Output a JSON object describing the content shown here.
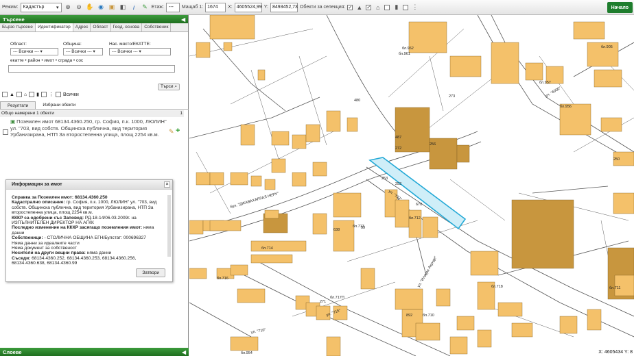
{
  "toolbar": {
    "mode_label": "Режим:",
    "mode_value": "Кадастър",
    "floor_label": "Етаж:",
    "floor_value": "---",
    "scale_label": "Мащаб 1:",
    "scale_value": "1674",
    "x_label": "X:",
    "x_value": "4605524,99",
    "y_label": "Y:",
    "y_value": "8493452,73",
    "objects_label": "Обекти за селекция:",
    "start_label": "Начало"
  },
  "panel": {
    "title": "Търсене",
    "tabs": [
      "Бързо търсене",
      "Идентификатор",
      "Адрес",
      "Област",
      "Геод. основа",
      "Собственик"
    ],
    "area_label": "Област:",
    "area_value": "--- Всички ---",
    "municipality_label": "Община:",
    "municipality_value": "--- Всички ---",
    "settlement_label": "Нас. място/ЕКАТТЕ:",
    "settlement_value": "--- Всички ---",
    "hint": "екатте • район • имот • сграда • сос",
    "search_button": "Търси",
    "all_label": "Всички",
    "results_tabs": [
      "Резултати",
      "Избрани обекти"
    ],
    "found_text": "Общо намерени 1 обекти",
    "found_count": "1",
    "result_text": "Поземлен имот 68134.4360.250, гр. София, п.к. 1000, ЛЮЛИН\" ул. \"703, вид собств. Общинска публична, вид територия Урбанизирана, НТП За второстепенна улица, площ 2254 кв.м.",
    "layers_title": "Слоеве"
  },
  "dialog": {
    "title": "Информация за имот",
    "close": "×",
    "h1": "Справка за Поземлен имот: 68134.4360.250",
    "l1": "Кадастрално описание:",
    "t1": " гр. София, п.к. 1000, ЛЮЛИН\" ул. \"703, вид собств. Общинска публична, вид територия Урбанизирана, НТП За второстепенна улица, площ 2254 кв.м.",
    "l2": "КККР са одобрени със Заповед:",
    "t2": " РД-18-14/06.03.2009г. на ИЗПЪЛНИТЕЛЕН ДИРЕКТОР НА АГКК",
    "l3": "Последно изменение на КККР засягащо поземления имот:",
    "t3": " няма данни",
    "l4": "Собственици:",
    "t4": " - СТОЛИЧНА ОБЩИНА ЕГН/Булстат: 000696327",
    "t5": "Няма данни за идеалните части",
    "t6": "Няма документ за собственост",
    "l7": "Носители на други вещни права:",
    "t7": " няма данни",
    "l8": "Съседи:",
    "t8": " 68134.4360.252, 68134.4360.253, 68134.4360.256, 68134.4360.638, 68134.4360.99",
    "button": "Затвори"
  },
  "map": {
    "labels": [
      {
        "t": "ул. \"703\"",
        "k": "street"
      },
      {
        "t": "бул. \"ДЖАВАХАРЛАЛ НЕРУ\"",
        "k": "street"
      },
      {
        "t": "ул. \"Илаура Акунде\"",
        "k": "street"
      },
      {
        "t": "ул. \"715\"",
        "k": "street"
      },
      {
        "t": "ул. \"710\"",
        "k": "street"
      },
      {
        "t": "ул. \"4000\"",
        "k": "street"
      },
      {
        "t": "бл.962",
        "k": "b"
      },
      {
        "t": "бл.961",
        "k": "b"
      },
      {
        "t": "бл.957",
        "k": "b"
      },
      {
        "t": "бл.956",
        "k": "b"
      },
      {
        "t": "бл.905",
        "k": "b"
      },
      {
        "t": "бл.713",
        "k": "b"
      },
      {
        "t": "бл.712",
        "k": "b"
      },
      {
        "t": "бл.714",
        "k": "b"
      },
      {
        "t": "бл.716",
        "k": "b"
      },
      {
        "t": "бл.717П",
        "k": "b"
      },
      {
        "t": "бл.710",
        "k": "b"
      },
      {
        "t": "бл.711",
        "k": "b"
      },
      {
        "t": "бл.718",
        "k": "b"
      },
      {
        "t": "бл.954",
        "k": "b"
      },
      {
        "t": "250",
        "k": "p"
      },
      {
        "t": "252",
        "k": "p"
      },
      {
        "t": "253",
        "k": "p"
      },
      {
        "t": "256",
        "k": "p"
      },
      {
        "t": "638",
        "k": "p"
      },
      {
        "t": "99",
        "k": "p"
      },
      {
        "t": "271",
        "k": "p"
      },
      {
        "t": "272",
        "k": "p"
      },
      {
        "t": "273",
        "k": "p"
      },
      {
        "t": "670",
        "k": "p"
      },
      {
        "t": "487",
        "k": "p"
      },
      {
        "t": "480",
        "k": "p"
      },
      {
        "t": "892",
        "k": "p"
      }
    ]
  },
  "status": {
    "coords": "X: 4605434 Y: 8"
  },
  "colors": {
    "green": "#2a862a",
    "building": "#f4c16a",
    "building_dark": "#c8963e",
    "selected": "#23a9d6"
  }
}
